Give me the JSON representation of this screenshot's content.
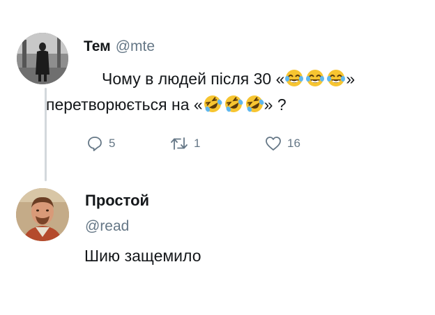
{
  "tweet1": {
    "name": "Тем",
    "handle": "@mte",
    "text_before": "Чому в людей після 30 «",
    "text_middle_1": "»",
    "text_middle_2": "перетворюється на «",
    "text_after": "» ?",
    "emoji_first": "face-with-tears-of-joy-icon",
    "emoji_second": "rolling-on-the-floor-laughing-icon",
    "stats": {
      "replies": "5",
      "retweets": "1",
      "likes": "16"
    }
  },
  "tweet2": {
    "name": "Простой",
    "handle": "@read",
    "text": "Шию защемило"
  },
  "colors": {
    "text": "#14171a",
    "secondary": "#657786",
    "thread_line": "#d3d8dc",
    "emoji": "#f7c531"
  }
}
